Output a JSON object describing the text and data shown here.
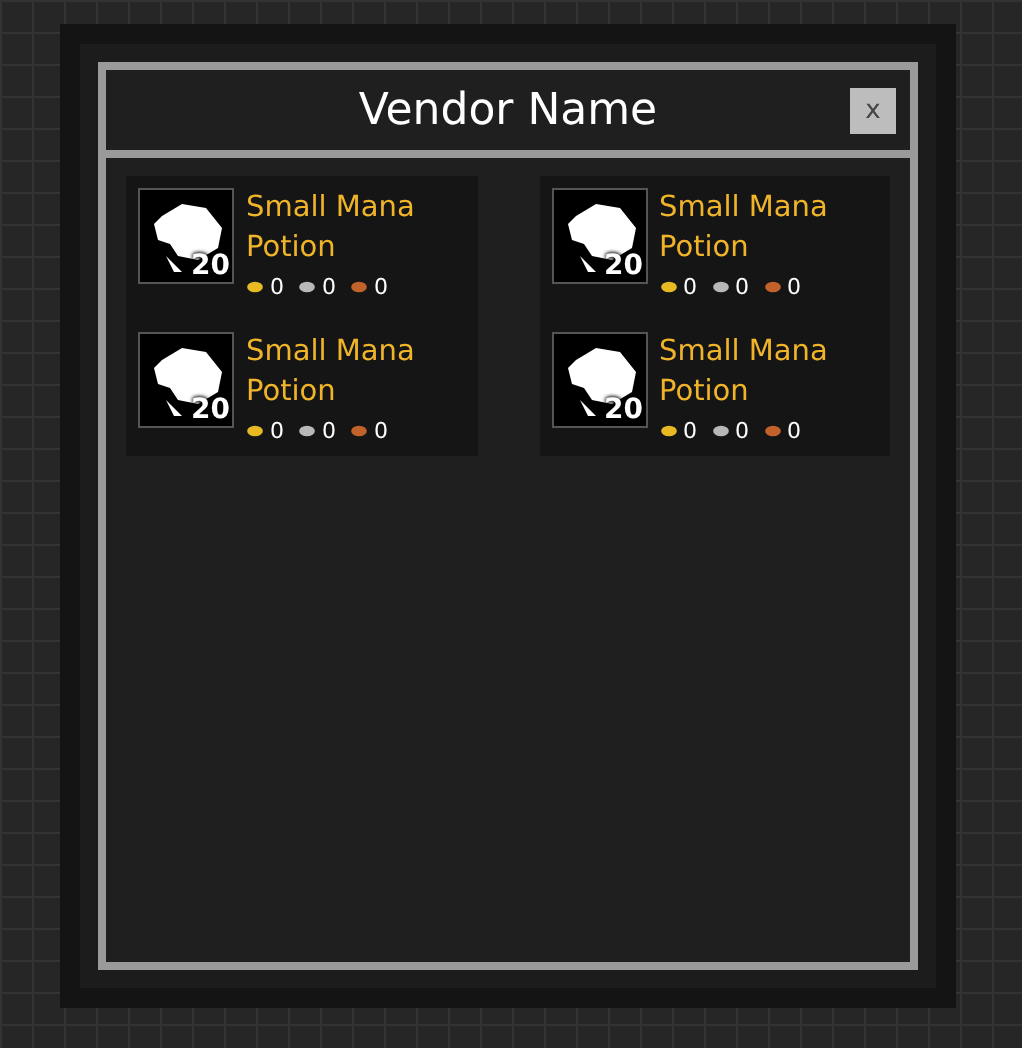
{
  "window": {
    "title": "Vendor Name",
    "close_label": "x"
  },
  "columns": [
    {
      "items": [
        {
          "name": "Small Mana Potion",
          "quantity": "20",
          "gold": "0",
          "silver": "0",
          "copper": "0"
        },
        {
          "name": "Small Mana Potion",
          "quantity": "20",
          "gold": "0",
          "silver": "0",
          "copper": "0"
        }
      ]
    },
    {
      "items": [
        {
          "name": "Small Mana Potion",
          "quantity": "20",
          "gold": "0",
          "silver": "0",
          "copper": "0"
        },
        {
          "name": "Small Mana Potion",
          "quantity": "20",
          "gold": "0",
          "silver": "0",
          "copper": "0"
        }
      ]
    }
  ]
}
